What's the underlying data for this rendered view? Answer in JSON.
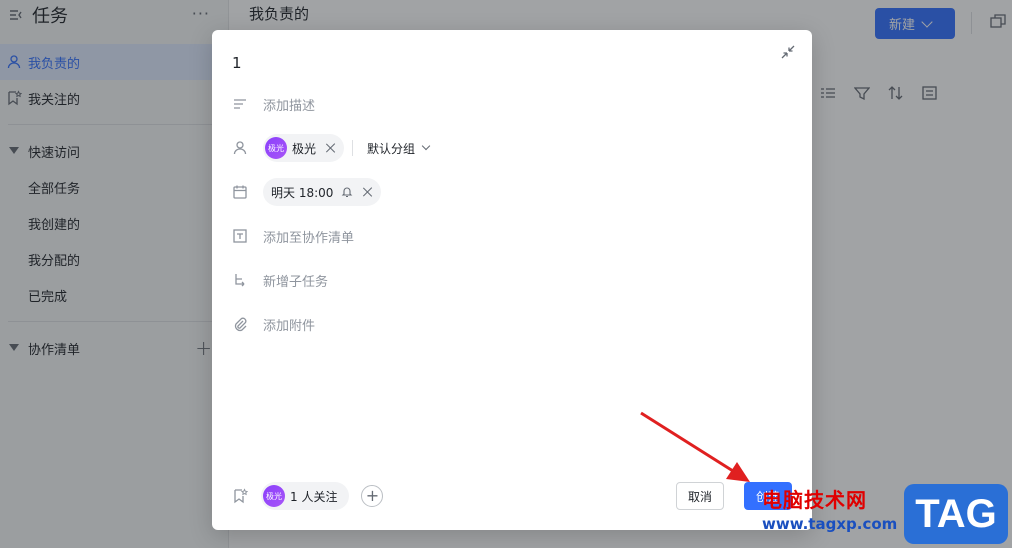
{
  "sidebar": {
    "title": "任务",
    "more": "···",
    "items": [
      {
        "label": "我负责的"
      },
      {
        "label": "我关注的"
      }
    ],
    "quick_access": {
      "label": "快速访问",
      "items": [
        {
          "label": "全部任务"
        },
        {
          "label": "我创建的"
        },
        {
          "label": "我分配的"
        },
        {
          "label": "已完成"
        }
      ]
    },
    "collab": {
      "label": "协作清单",
      "add": "+"
    }
  },
  "main": {
    "title": "我负责的",
    "new_button": "新建"
  },
  "modal": {
    "task_title": "1",
    "description_placeholder": "添加描述",
    "assignee": {
      "avatar_text": "极光",
      "name": "极光"
    },
    "group": "默认分组",
    "due": "明天 18:00",
    "add_to_list": "添加至协作清单",
    "add_subtask": "新增子任务",
    "add_attachment": "添加附件",
    "followers": {
      "avatar_text": "极光",
      "label": "1 人关注"
    },
    "cancel": "取消",
    "create": "创建"
  },
  "watermark": {
    "text": "电脑技术网",
    "url": "www.tagxp.com",
    "tag": "TAG"
  },
  "colors": {
    "accent": "#3370ff",
    "overlay": "rgba(31,35,41,0.42)",
    "annotation_arrow": "#e02020"
  }
}
